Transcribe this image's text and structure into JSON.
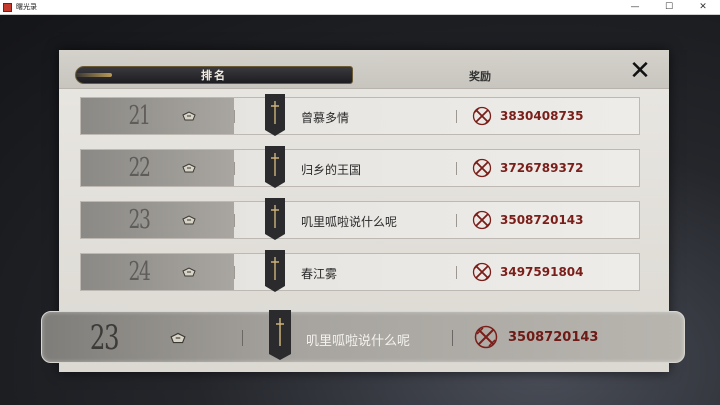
{
  "window": {
    "title": "曙光录",
    "controls": {
      "minimize": "—",
      "maximize": "☐",
      "close": "✕"
    }
  },
  "tabs": {
    "rank_label": "排名",
    "reward_label": "奖励"
  },
  "colors": {
    "score_red": "#7a1e1a",
    "tab_dark": "#1e1e22",
    "panel_bg": "#e4e2dd"
  },
  "rows": [
    {
      "rank": "21",
      "name": "曾慕多情",
      "score": "3830408735"
    },
    {
      "rank": "22",
      "name": "归乡的王国",
      "score": "3726789372"
    },
    {
      "rank": "23",
      "name": "叽里呱啦说什么呢",
      "score": "3508720143"
    },
    {
      "rank": "24",
      "name": "春江雾",
      "score": "3497591804"
    }
  ],
  "self_row": {
    "rank": "23",
    "name": "叽里呱啦说什么呢",
    "score": "3508720143"
  },
  "icons": {
    "close": "close-icon",
    "emblem": "guild-emblem-icon",
    "banner": "sword-banner-icon",
    "reward": "crossed-swords-icon"
  }
}
